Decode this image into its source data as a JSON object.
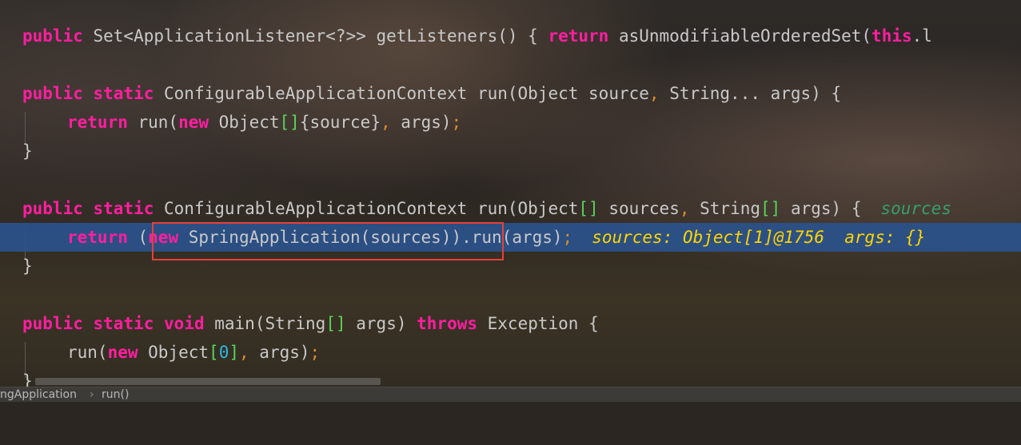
{
  "code": {
    "line1": {
      "kw_public": "public",
      "t1": " Set<ApplicationListener<?>> getListeners() { ",
      "kw_return": "return",
      "t2": " asUnmodifiableOrderedSet(",
      "kw_this": "this",
      "t3": ".l"
    },
    "line2": {
      "kw_public": "public",
      "kw_static": "static",
      "t1": " ConfigurableApplicationContext run(Object source",
      "comma": ",",
      "t2": " String... args) {"
    },
    "line3": {
      "kw_return": "return",
      "t1": " run(",
      "kw_new": "new",
      "t2": " Object",
      "brackets": "[]",
      "t3": "{source}",
      "comma": ",",
      "t4": " args)",
      "semi": ";"
    },
    "line4": {
      "brace": "}"
    },
    "line5": {
      "kw_public": "public",
      "kw_static": "static",
      "t1": " ConfigurableApplicationContext run(Object",
      "brackets1": "[]",
      "t2": " sources",
      "comma": ",",
      "t3": " String",
      "brackets2": "[]",
      "t4": " args) {",
      "inlay": "sources"
    },
    "line6": {
      "kw_return": "return",
      "t1": " (",
      "kw_new": "new",
      "t2": " SpringApplication(sources)).run(args)",
      "semi": ";",
      "inlay": "sources: Object[1]@1756  args: {}"
    },
    "line7": {
      "brace": "}"
    },
    "line8": {
      "kw_public": "public",
      "kw_static": "static",
      "kw_void": "void",
      "t1": " main(String",
      "brackets": "[]",
      "t2": " args) ",
      "kw_throws": "throws",
      "t3": " Exception {"
    },
    "line9": {
      "t1": "run(",
      "kw_new": "new",
      "t2": " Object",
      "lb": "[",
      "zero": "0",
      "rb": "]",
      "comma": ",",
      "t3": " args)",
      "semi": ";"
    },
    "line10": {
      "brace": "}"
    }
  },
  "breadcrumbs": {
    "class": "ngApplication",
    "method": "run()",
    "separator": "›"
  },
  "colors": {
    "keyword": "#ff1ea0",
    "bracket": "#59d35a",
    "comma": "#d98c2a",
    "number": "#2fb8e0",
    "debug_inlay": "#ffd400",
    "execution_line": "#2a528c",
    "highlight_box": "#e4413a"
  }
}
